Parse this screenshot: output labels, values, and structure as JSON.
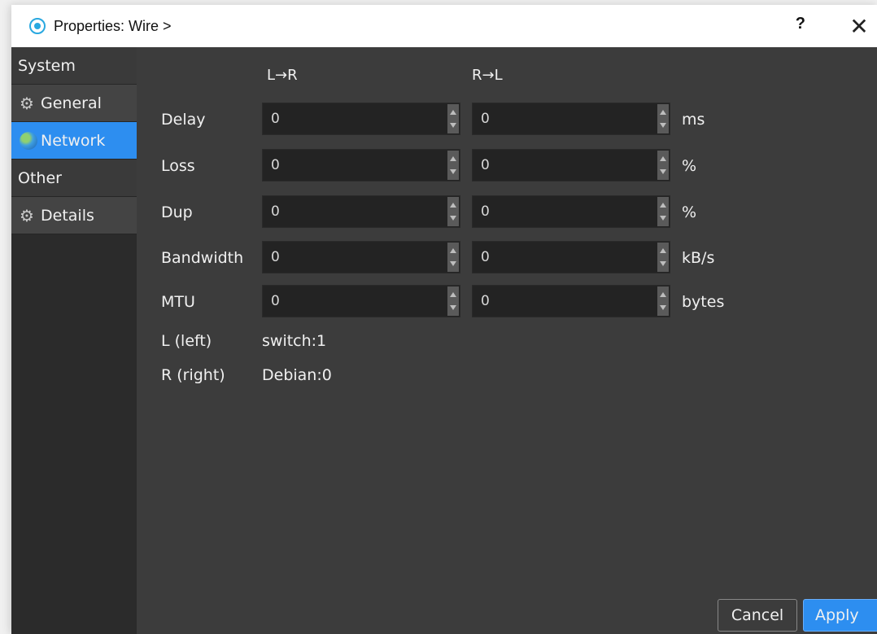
{
  "window": {
    "title": "Properties: Wire >",
    "help_glyph": "?",
    "close_glyph": "✕"
  },
  "sidebar": {
    "items": [
      {
        "label": "System",
        "kind": "category"
      },
      {
        "label": "General",
        "kind": "page",
        "icon": "gear-icon"
      },
      {
        "label": "Network",
        "kind": "page",
        "icon": "globe-icon",
        "selected": true
      },
      {
        "label": "Other",
        "kind": "category"
      },
      {
        "label": "Details",
        "kind": "page",
        "icon": "gears-icon"
      }
    ]
  },
  "network": {
    "col_left": "L→R",
    "col_right": "R→L",
    "rows": [
      {
        "label": "Delay",
        "left_value": "0",
        "right_value": "0",
        "unit": "ms"
      },
      {
        "label": "Loss",
        "left_value": "0",
        "right_value": "0",
        "unit": "%"
      },
      {
        "label": "Dup",
        "left_value": "0",
        "right_value": "0",
        "unit": "%"
      },
      {
        "label": "Bandwidth",
        "left_value": "0",
        "right_value": "0",
        "unit": "kB/s"
      },
      {
        "label": "MTU",
        "left_value": "0",
        "right_value": "0",
        "unit": "bytes"
      }
    ],
    "left_endpoint_label": "L (left)",
    "left_endpoint_value": "switch:1",
    "right_endpoint_label": "R (right)",
    "right_endpoint_value": "Debian:0"
  },
  "buttons": {
    "cancel": "Cancel",
    "apply": "Apply"
  },
  "colors": {
    "accent": "#2d8ef0",
    "panel": "#3c3c3c",
    "sidebar": "#2b2b2b"
  }
}
